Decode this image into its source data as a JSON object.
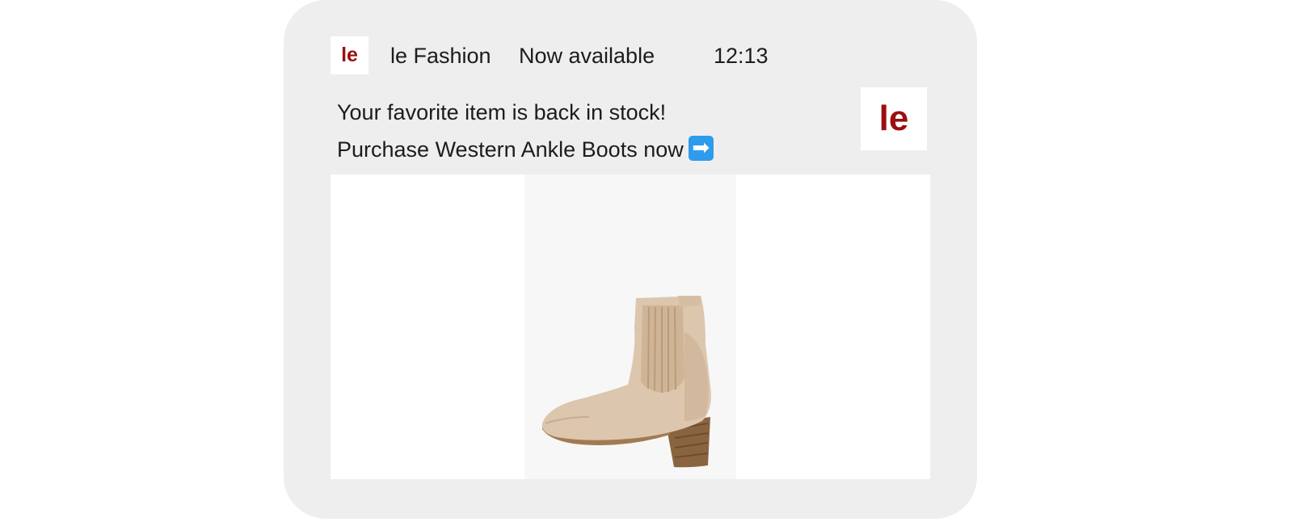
{
  "notification": {
    "app_icon_text": "le",
    "app_name": "le Fashion",
    "status": "Now available",
    "time": "12:13",
    "message_line1": "Your favorite item is back in stock!",
    "message_line2": "Purchase Western Ankle Boots now",
    "arrow_glyph": "➡",
    "thumbnail_text": "le",
    "product_image_icon": "ankle-boot-image"
  },
  "colors": {
    "brand": "#9b1010",
    "card_background": "#eeeeee",
    "arrow_emoji": "#2e9bec",
    "boot_suede": "#dcc6ae"
  }
}
